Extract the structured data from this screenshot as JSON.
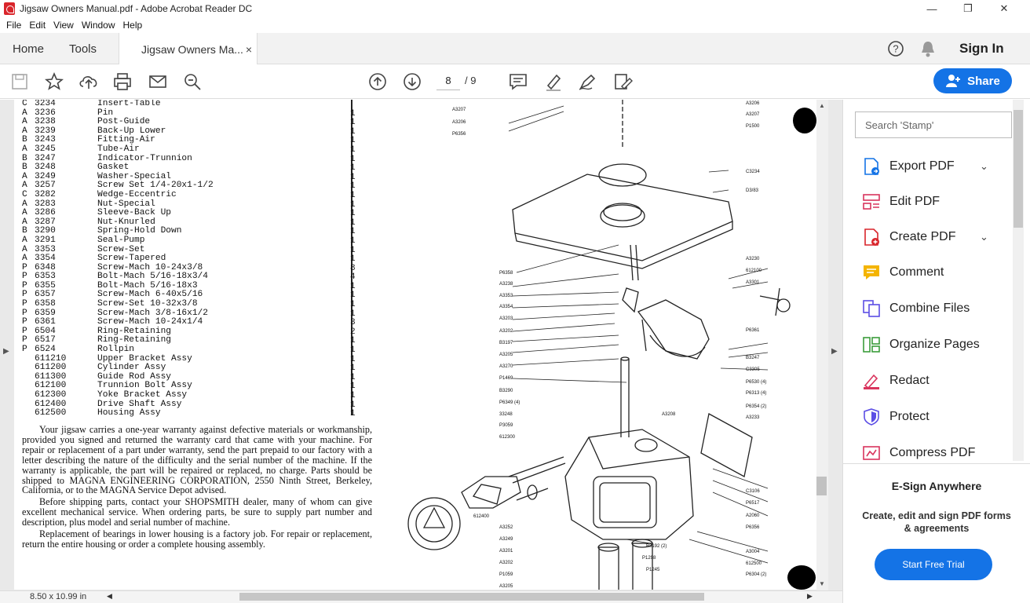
{
  "window": {
    "title": "Jigsaw Owners Manual.pdf - Adobe Acrobat Reader DC",
    "minimize": "—",
    "maximize": "❐",
    "close": "✕"
  },
  "menu": [
    "File",
    "Edit",
    "View",
    "Window",
    "Help"
  ],
  "tabs": {
    "home": "Home",
    "tools": "Tools",
    "document": "Jigsaw Owners Ma...",
    "close": "×"
  },
  "header": {
    "sign_in": "Sign In"
  },
  "toolbar": {
    "page_current": "8",
    "page_total": "/ 9",
    "share": "Share"
  },
  "parts_list": [
    {
      "g": "C",
      "n": "3234",
      "d": "Insert-Table"
    },
    {
      "g": "A",
      "n": "3236",
      "d": "Pin"
    },
    {
      "g": "A",
      "n": "3238",
      "d": "Post-Guide"
    },
    {
      "g": "A",
      "n": "3239",
      "d": "Back-Up Lower"
    },
    {
      "g": "B",
      "n": "3243",
      "d": "Fitting-Air"
    },
    {
      "g": "A",
      "n": "3245",
      "d": "Tube-Air"
    },
    {
      "g": "B",
      "n": "3247",
      "d": "Indicator-Trunnion"
    },
    {
      "g": "B",
      "n": "3248",
      "d": "Gasket"
    },
    {
      "g": "A",
      "n": "3249",
      "d": "Washer-Special"
    },
    {
      "g": "A",
      "n": "3257",
      "d": "Screw Set 1/4-20x1-1/2"
    },
    {
      "g": "C",
      "n": "3282",
      "d": "Wedge-Eccentric"
    },
    {
      "g": "A",
      "n": "3283",
      "d": "Nut-Special"
    },
    {
      "g": "A",
      "n": "3286",
      "d": "Sleeve-Back Up"
    },
    {
      "g": "A",
      "n": "3287",
      "d": "Nut-Knurled"
    },
    {
      "g": "B",
      "n": "3290",
      "d": "Spring-Hold Down"
    },
    {
      "g": "A",
      "n": "3291",
      "d": "Seal-Pump"
    },
    {
      "g": "A",
      "n": "3353",
      "d": "Screw-Set"
    },
    {
      "g": "A",
      "n": "3354",
      "d": "Screw-Tapered"
    },
    {
      "g": "P",
      "n": "6348",
      "d": "Screw-Mach 10-24x3/8"
    },
    {
      "g": "P",
      "n": "6353",
      "d": "Bolt-Mach 5/16-18x3/4"
    },
    {
      "g": "P",
      "n": "6355",
      "d": "Bolt-Mach 5/16-18x3"
    },
    {
      "g": "P",
      "n": "6357",
      "d": "Screw-Mach 6-40x5/16"
    },
    {
      "g": "P",
      "n": "6358",
      "d": "Screw-Set 10-32x3/8"
    },
    {
      "g": "P",
      "n": "6359",
      "d": "Screw-Mach 3/8-16x1/2"
    },
    {
      "g": "P",
      "n": "6361",
      "d": "Screw-Mach 10-24x1/4"
    },
    {
      "g": "P",
      "n": "6504",
      "d": "Ring-Retaining"
    },
    {
      "g": "P",
      "n": "6517",
      "d": "Ring-Retaining"
    },
    {
      "g": "P",
      "n": "6524",
      "d": "Rollpin"
    },
    {
      "g": "",
      "n": "611210",
      "d": "Upper Bracket Assy"
    },
    {
      "g": "",
      "n": "611200",
      "d": "Cylinder Assy"
    },
    {
      "g": "",
      "n": "611300",
      "d": "Guide Rod Assy"
    },
    {
      "g": "",
      "n": "612100",
      "d": "Trunnion Bolt Assy"
    },
    {
      "g": "",
      "n": "612300",
      "d": "Yoke Bracket Assy"
    },
    {
      "g": "",
      "n": "612400",
      "d": "Drive Shaft Assy"
    },
    {
      "g": "",
      "n": "612500",
      "d": "Housing Assy"
    }
  ],
  "quantities": [
    "",
    "1",
    "1",
    "1",
    "1",
    "1",
    "1",
    "1",
    "1",
    "1",
    "1",
    "1",
    "1",
    "1",
    "1",
    "1",
    "1",
    "1",
    "8",
    "4",
    "1",
    "1",
    "1",
    "1",
    "3",
    "2",
    "1",
    "1",
    "1",
    "1",
    "1",
    "1",
    "1",
    "1",
    "1"
  ],
  "warranty": [
    "Your jigsaw carries a one-year warranty against defective materials or workmanship, provided you signed and returned the warranty card that came with your machine. For repair or replacement of a part under warranty, send the part prepaid to our factory with a letter describing the nature of the difficulty and the serial number of the machine. If the warranty is applicable, the part will be repaired or replaced, no charge. Parts should be shipped to MAGNA ENGINEERING CORPORATION, 2550 Ninth Street, Berkeley, California, or to the MAGNA Service Depot advised.",
    "Before shipping parts, contact your SHOPSMITH dealer, many of whom can give excellent mechanical service. When ordering parts, be sure to supply part number and description, plus model and serial number of machine.",
    "Replacement of bearings in lower housing is a factory job. For repair or replacement, return the entire housing or order a complete housing assembly."
  ],
  "diagram_labels": [
    "A3207",
    "A3206",
    "P6356",
    "A3206",
    "A3207",
    "P1500",
    "C3234",
    "D3/83",
    "P6358",
    "A3238",
    "A3353",
    "A3354",
    "A3203",
    "A3202",
    "B3197",
    "A3205",
    "A3270",
    "A3230",
    "612100",
    "A3301",
    "P6361",
    "B3247",
    "C3305",
    "P6530 (4)",
    "P6313 (4)",
    "P6354 (2)",
    "A3233",
    "A3208",
    "P1469",
    "B3290",
    "P6349 (4)",
    "33248",
    "P3059",
    "612300",
    "612400",
    "A3252",
    "A3249",
    "A3201",
    "A3202",
    "P1059",
    "A3205",
    "C3106",
    "P6517",
    "A2060",
    "P6356",
    "A3004",
    "612500",
    "P6304 (2)",
    "B3192 (2)",
    "P1298",
    "P1245"
  ],
  "status": {
    "page_size": "8.50 x 10.99 in"
  },
  "right_panel": {
    "search_placeholder": "Search 'Stamp'",
    "tools": [
      "Export PDF",
      "Edit PDF",
      "Create PDF",
      "Comment",
      "Combine Files",
      "Organize Pages",
      "Redact",
      "Protect",
      "Compress PDF"
    ],
    "esign_title": "E-Sign Anywhere",
    "esign_desc": "Create, edit and sign PDF forms & agreements",
    "trial_button": "Start Free Trial"
  },
  "colors": {
    "accent": "#1473e6",
    "acrobat_red": "#d9252b"
  }
}
